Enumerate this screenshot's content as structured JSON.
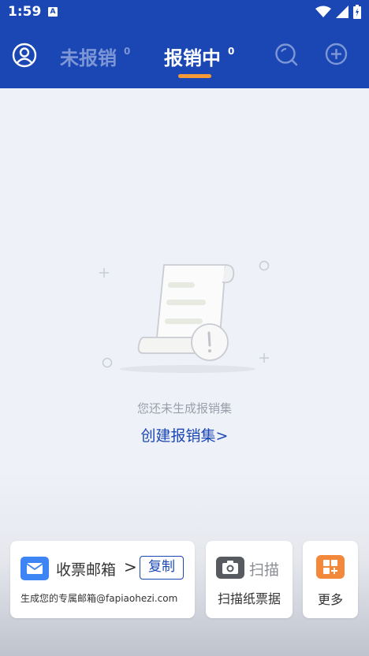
{
  "status_bar": {
    "time": "1:59",
    "notification_badge": "A"
  },
  "header": {
    "tabs": [
      {
        "label": "未报销",
        "count": "0",
        "active": false
      },
      {
        "label": "报销中",
        "count": "0",
        "active": true
      }
    ],
    "icons": [
      "user-icon",
      "search-icon",
      "add-icon"
    ],
    "accent_color": "#f59a36",
    "bg_color": "#1b47b4"
  },
  "empty_state": {
    "message": "您还未生成报销集",
    "action_label": "创建报销集>"
  },
  "cards": {
    "mail": {
      "title": "收票邮箱",
      "chevron": ">",
      "copy_label": "复制",
      "subtitle": "生成您的专属邮箱@fapiaohezi.com"
    },
    "scan": {
      "title": "扫描",
      "subtitle": "扫描纸票据"
    },
    "more": {
      "title": "更多"
    }
  }
}
